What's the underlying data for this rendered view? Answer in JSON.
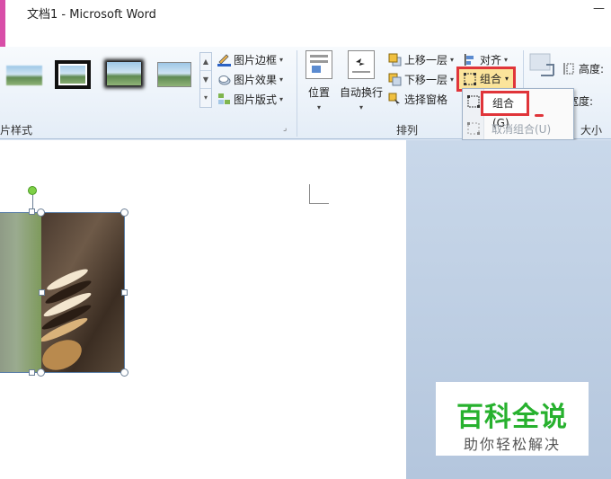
{
  "window": {
    "title": "文档1 - Microsoft Word",
    "minimize_glyph": "—"
  },
  "ribbon": {
    "picture_styles": {
      "group_label": "片样式",
      "border_label": "图片边框",
      "effects_label": "图片效果",
      "layout_label": "图片版式"
    },
    "arrange": {
      "group_label": "排列",
      "position_label": "位置",
      "wrap_label": "自动换行",
      "bring_forward_label": "上移一层",
      "send_backward_label": "下移一层",
      "selection_pane_label": "选择窗格",
      "align_label": "对齐",
      "group_button_label": "组合"
    },
    "size": {
      "group_label": "大小",
      "height_label": "高度:",
      "width_label": "宽度:"
    }
  },
  "group_menu": {
    "group_item": "组合(G)",
    "ungroup_item": "取消组合(U)"
  },
  "watermark": {
    "main": "百科全说",
    "sub": "助你轻松解决"
  },
  "colors": {
    "title_accent": "#d84ea8",
    "highlight_red": "#e0353a",
    "logo_green": "#27b12e"
  }
}
